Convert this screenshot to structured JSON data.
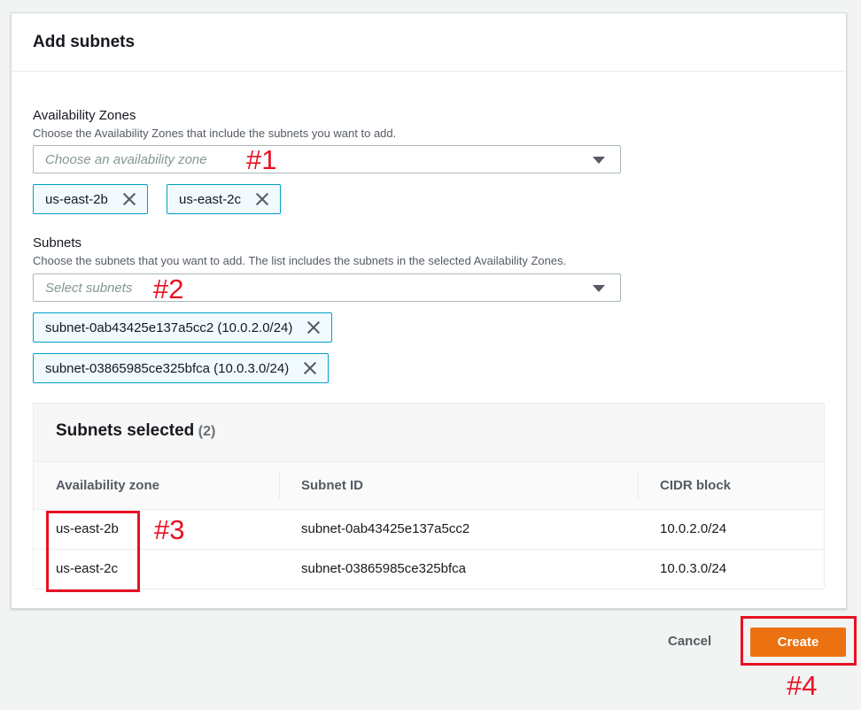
{
  "modal": {
    "title": "Add subnets"
  },
  "availability_zones": {
    "label": "Availability Zones",
    "description": "Choose the Availability Zones that include the subnets you want to add.",
    "placeholder": "Choose an availability zone",
    "tokens": [
      "us-east-2b",
      "us-east-2c"
    ]
  },
  "subnets": {
    "label": "Subnets",
    "description": "Choose the subnets that you want to add. The list includes the subnets in the selected Availability Zones.",
    "placeholder": "Select subnets",
    "tokens": [
      "subnet-0ab43425e137a5cc2 (10.0.2.0/24)",
      "subnet-03865985ce325bfca (10.0.3.0/24)"
    ]
  },
  "selected_table": {
    "title": "Subnets selected",
    "count": "(2)",
    "columns": [
      "Availability zone",
      "Subnet ID",
      "CIDR block"
    ],
    "rows": [
      [
        "us-east-2b",
        "subnet-0ab43425e137a5cc2",
        "10.0.2.0/24"
      ],
      [
        "us-east-2c",
        "subnet-03865985ce325bfca",
        "10.0.3.0/24"
      ]
    ]
  },
  "footer": {
    "cancel_label": "Cancel",
    "create_label": "Create"
  },
  "annotations": {
    "one": "#1",
    "two": "#2",
    "three": "#3",
    "four": "#4"
  },
  "colors": {
    "accent": "#ec7211",
    "token_border": "#00a1c9",
    "annotation": "#e81123"
  }
}
